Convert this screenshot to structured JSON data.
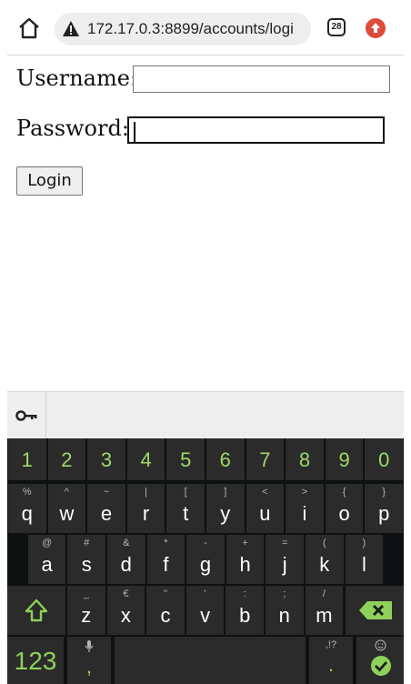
{
  "browser": {
    "url": "172.17.0.3:8899/accounts/logi",
    "tab_count": "28"
  },
  "form": {
    "username_label": "Username:",
    "password_label": "Password:",
    "login_label": "Login",
    "username_value": "",
    "password_value": ""
  },
  "keyboard": {
    "numbers": [
      "1",
      "2",
      "3",
      "4",
      "5",
      "6",
      "7",
      "8",
      "9",
      "0"
    ],
    "row1": [
      {
        "k": "q",
        "s": "%"
      },
      {
        "k": "w",
        "s": "^"
      },
      {
        "k": "e",
        "s": "~"
      },
      {
        "k": "r",
        "s": "|"
      },
      {
        "k": "t",
        "s": "["
      },
      {
        "k": "y",
        "s": "]"
      },
      {
        "k": "u",
        "s": "<"
      },
      {
        "k": "i",
        "s": ">"
      },
      {
        "k": "o",
        "s": "{"
      },
      {
        "k": "p",
        "s": "}"
      }
    ],
    "row2": [
      {
        "k": "a",
        "s": "@"
      },
      {
        "k": "s",
        "s": "#"
      },
      {
        "k": "d",
        "s": "&"
      },
      {
        "k": "f",
        "s": "*"
      },
      {
        "k": "g",
        "s": "-"
      },
      {
        "k": "h",
        "s": "+"
      },
      {
        "k": "j",
        "s": "="
      },
      {
        "k": "k",
        "s": "("
      },
      {
        "k": "l",
        "s": ")"
      }
    ],
    "row3": [
      {
        "k": "z",
        "s": "_"
      },
      {
        "k": "x",
        "s": "€"
      },
      {
        "k": "c",
        "s": "\""
      },
      {
        "k": "v",
        "s": "'"
      },
      {
        "k": "b",
        "s": ":"
      },
      {
        "k": "n",
        "s": ";"
      },
      {
        "k": "m",
        "s": "/"
      }
    ],
    "symbols_label": "123",
    "comma": ",",
    "period": ".",
    "period_sub": ",!?"
  },
  "icons": {
    "home": "home-icon",
    "warning": "warning-icon",
    "tabs": "tabs-icon",
    "update": "update-icon",
    "key": "key-icon",
    "shift": "shift-icon",
    "backspace": "backspace-icon",
    "mic": "mic-icon",
    "emoji": "emoji-icon",
    "enter": "checkmark-icon"
  },
  "colors": {
    "keyboard_accent": "#8fd15a",
    "update_badge": "#dd4b39"
  }
}
